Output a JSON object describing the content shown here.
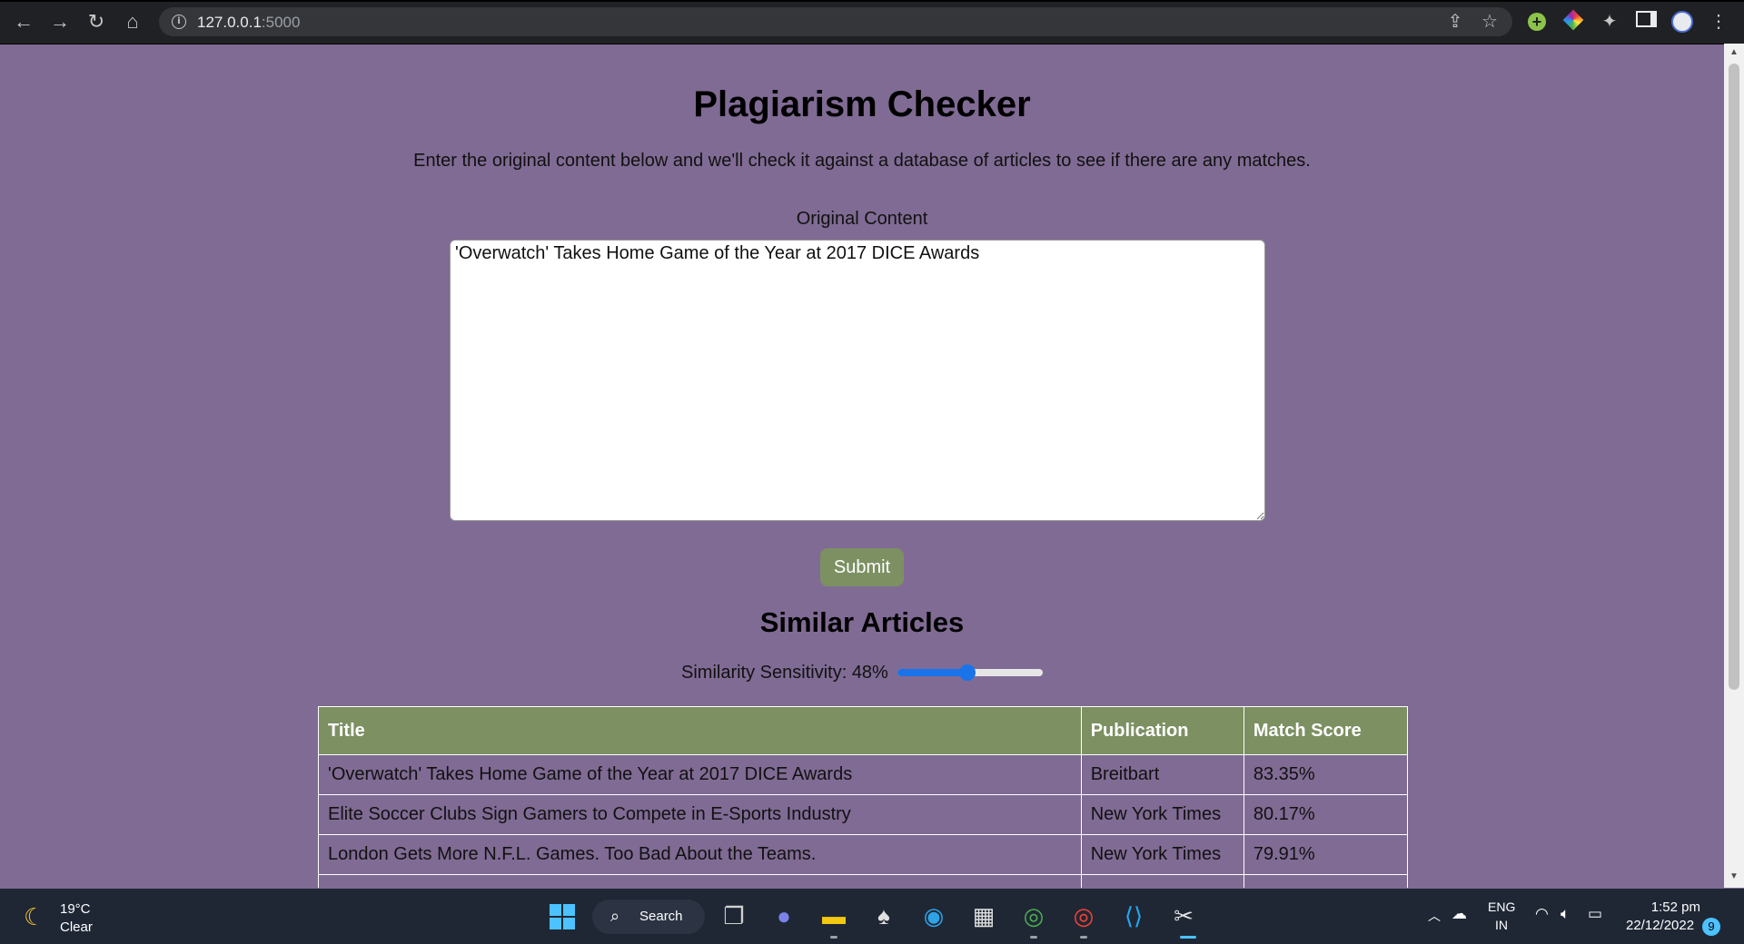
{
  "browser": {
    "url_host": "127.0.0.1",
    "url_port": ":5000",
    "icons": [
      "back-icon",
      "forward-icon",
      "reload-icon",
      "home-icon",
      "site-info-icon",
      "share-icon",
      "bookmark-star-icon",
      "extension-plus-icon",
      "extension-color-icon",
      "extensions-puzzle-icon",
      "side-panel-icon",
      "profile-avatar-icon",
      "menu-kebab-icon"
    ]
  },
  "page": {
    "title": "Plagiarism Checker",
    "description": "Enter the original content below and we'll check it against a database of articles to see if there are any matches.",
    "content_label": "Original Content",
    "content_value": "'Overwatch' Takes Home Game of the Year at 2017 DICE Awards",
    "submit_label": "Submit",
    "similar_heading": "Similar Articles",
    "sensitivity_label": "Similarity Sensitivity: 48%",
    "sensitivity_value": 48
  },
  "table": {
    "headers": [
      "Title",
      "Publication",
      "Match Score"
    ],
    "rows": [
      {
        "title": "'Overwatch' Takes Home Game of the Year at 2017 DICE Awards",
        "publication": "Breitbart",
        "score": "83.35%"
      },
      {
        "title": "Elite Soccer Clubs Sign Gamers to Compete in E-Sports Industry",
        "publication": "New York Times",
        "score": "80.17%"
      },
      {
        "title": "London Gets More N.F.L. Games. Too Bad About the Teams.",
        "publication": "New York Times",
        "score": "79.91%"
      }
    ]
  },
  "taskbar": {
    "weather_temp": "19°C",
    "weather_cond": "Clear",
    "search_label": "Search",
    "lang_line1": "ENG",
    "lang_line2": "IN",
    "time": "1:52 pm",
    "date": "22/12/2022",
    "notification_count": "9",
    "accent_color": "#4cc2ff"
  },
  "colors": {
    "page_background": "#806b94",
    "accent_green": "#7c9062",
    "slider_blue": "#1a73e8"
  }
}
